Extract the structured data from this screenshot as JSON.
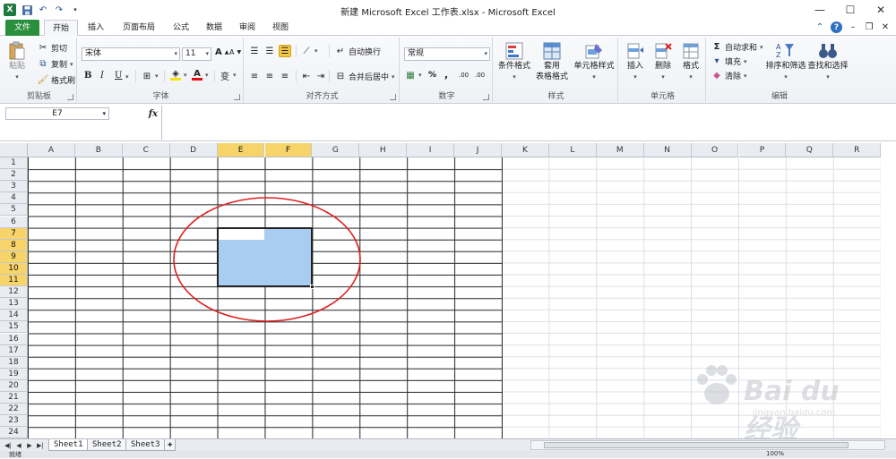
{
  "window": {
    "title": "新建 Microsoft Excel 工作表.xlsx - Microsoft Excel",
    "logo_letter": "X",
    "minimize": "—",
    "maximize": "☐",
    "close": "✕"
  },
  "qat": {
    "save_icon": "save-icon",
    "undo_icon": "undo-icon",
    "redo_icon": "redo-icon"
  },
  "tabs": [
    {
      "label": "文件"
    },
    {
      "label": "开始"
    },
    {
      "label": "插入"
    },
    {
      "label": "页面布局"
    },
    {
      "label": "公式"
    },
    {
      "label": "数据"
    },
    {
      "label": "审阅"
    },
    {
      "label": "视图"
    }
  ],
  "ribbon": {
    "clipboard": {
      "label": "剪贴板",
      "paste": "粘贴",
      "cut": "剪切",
      "copy": "复制",
      "format_painter": "格式刷"
    },
    "font": {
      "label": "字体",
      "font_name": "宋体",
      "font_size": "11",
      "bold": "B",
      "italic": "I",
      "underline": "U",
      "grow": "A",
      "shrink": "A",
      "wen": "变"
    },
    "alignment": {
      "label": "对齐方式",
      "wrap_text": "自动换行",
      "merge_center": "合并后居中"
    },
    "number": {
      "label": "数字",
      "format": "常规",
      "percent": "%",
      "comma": ",",
      "inc_dec": ".00",
      "dec_dec": ".00"
    },
    "styles": {
      "label": "样式",
      "conditional": "条件格式",
      "table_format_1": "套用",
      "table_format_2": "表格格式",
      "cell_styles": "单元格样式"
    },
    "cells": {
      "label": "单元格",
      "insert": "插入",
      "delete": "删除",
      "format": "格式"
    },
    "editing": {
      "label": "编辑",
      "autosum": "自动求和",
      "fill": "填充",
      "clear": "清除",
      "sort_filter": "排序和筛选",
      "find_select": "查找和选择",
      "sigma": "Σ"
    }
  },
  "formula_bar": {
    "name_box": "E7",
    "fx": "fx",
    "value": ""
  },
  "grid": {
    "columns": [
      "A",
      "B",
      "C",
      "D",
      "E",
      "F",
      "G",
      "H",
      "I",
      "J",
      "K",
      "L",
      "M",
      "N",
      "O",
      "P",
      "Q",
      "R"
    ],
    "rows": [
      "1",
      "2",
      "3",
      "4",
      "5",
      "6",
      "7",
      "8",
      "9",
      "10",
      "11",
      "12",
      "13",
      "14",
      "15",
      "16",
      "17",
      "18",
      "19",
      "20",
      "21",
      "22",
      "23",
      "24"
    ],
    "selected_columns": [
      "E",
      "F"
    ],
    "selected_rows": [
      "7",
      "8",
      "9",
      "10",
      "11"
    ],
    "active_cell": "E7",
    "selection": "E7:F11",
    "bordered_range": "A1:J24",
    "colors": {
      "selection_fill": "#a9cdf0",
      "header_selected": "#f7d46a",
      "annotation": "#e02020"
    }
  },
  "sheets": [
    {
      "label": "Sheet1"
    },
    {
      "label": "Sheet2"
    },
    {
      "label": "Sheet3"
    }
  ],
  "status": {
    "ready": "就绪",
    "zoom": "100%"
  },
  "watermark": {
    "brand": "Bai du 经验",
    "url": "jingyan.baidu.com"
  }
}
